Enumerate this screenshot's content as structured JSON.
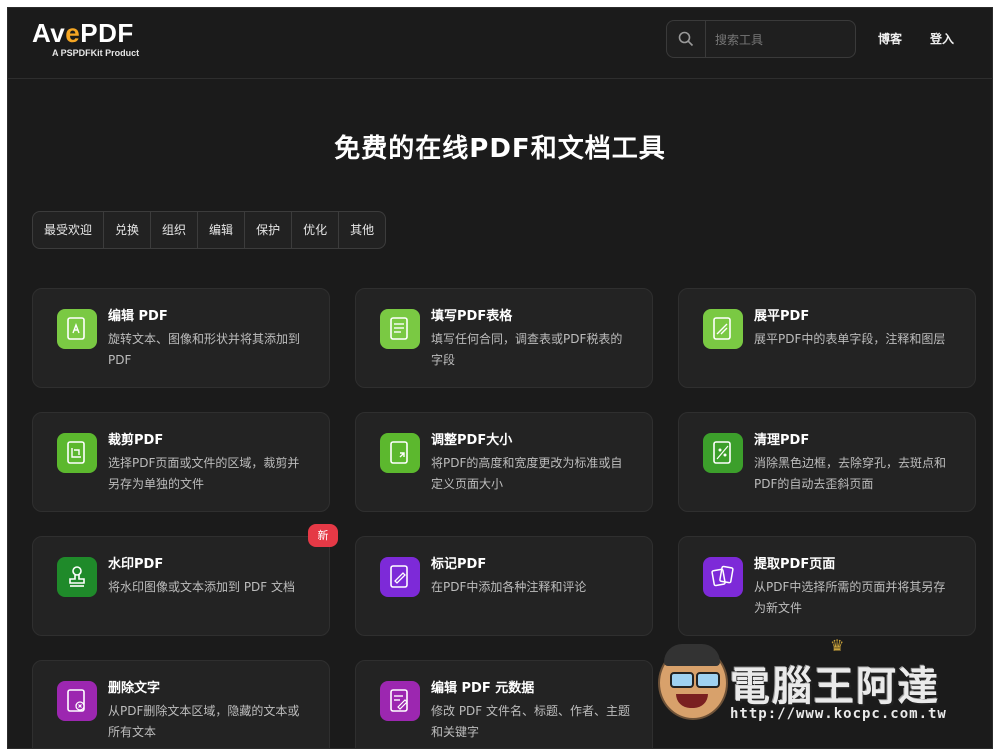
{
  "header": {
    "logo_text_a": "Av",
    "logo_text_b": "e",
    "logo_text_c": "PDF",
    "logo_sub": "A PSPDFKit Product",
    "search_placeholder": "搜索工具",
    "nav": [
      "博客",
      "登入"
    ]
  },
  "hero": {
    "title": "免费的在线PDF和文档工具"
  },
  "tabs": [
    "最受欢迎",
    "兑换",
    "组织",
    "编辑",
    "保护",
    "优化",
    "其他"
  ],
  "tools": [
    {
      "title": "编辑 PDF",
      "desc": "旋转文本、图像和形状并将其添加到 PDF",
      "color": "#7ac943",
      "icon": "edit-pdf-icon"
    },
    {
      "title": "填写PDF表格",
      "desc": "填写任何合同，调查表或PDF税表的字段",
      "color": "#7ac943",
      "icon": "fill-form-icon"
    },
    {
      "title": "展平PDF",
      "desc": "展平PDF中的表单字段，注释和图层",
      "color": "#7ac943",
      "icon": "flatten-icon"
    },
    {
      "title": "裁剪PDF",
      "desc": "选择PDF页面或文件的区域，裁剪并另存为单独的文件",
      "color": "#5cb82e",
      "icon": "crop-icon"
    },
    {
      "title": "调整PDF大小",
      "desc": "将PDF的高度和宽度更改为标准或自定义页面大小",
      "color": "#5cb82e",
      "icon": "resize-icon"
    },
    {
      "title": "清理PDF",
      "desc": "消除黑色边框，去除穿孔，去斑点和PDF的自动去歪斜页面",
      "color": "#3c9f2b",
      "icon": "clean-icon"
    },
    {
      "title": "水印PDF",
      "desc": "将水印图像或文本添加到 PDF 文档",
      "color": "#1f8a2a",
      "icon": "stamp-icon"
    },
    {
      "title": "标记PDF",
      "desc": "在PDF中添加各种注释和评论",
      "color": "#7d2ad8",
      "icon": "markup-icon"
    },
    {
      "title": "提取PDF页面",
      "desc": "从PDF中选择所需的页面并将其另存为新文件",
      "color": "#7d2ad8",
      "icon": "extract-icon"
    },
    {
      "title": "删除文字",
      "desc": "从PDF删除文本区域，隐藏的文本或所有文本",
      "color": "#9c27b0",
      "icon": "delete-text-icon"
    },
    {
      "title": "编辑 PDF 元数据",
      "desc": "修改 PDF 文件名、标题、作者、主题和关键字",
      "color": "#9c27b0",
      "icon": "metadata-icon"
    }
  ],
  "badge": "新",
  "watermark": {
    "text": "電腦王阿達",
    "url": "http://www.kocpc.com.tw"
  }
}
